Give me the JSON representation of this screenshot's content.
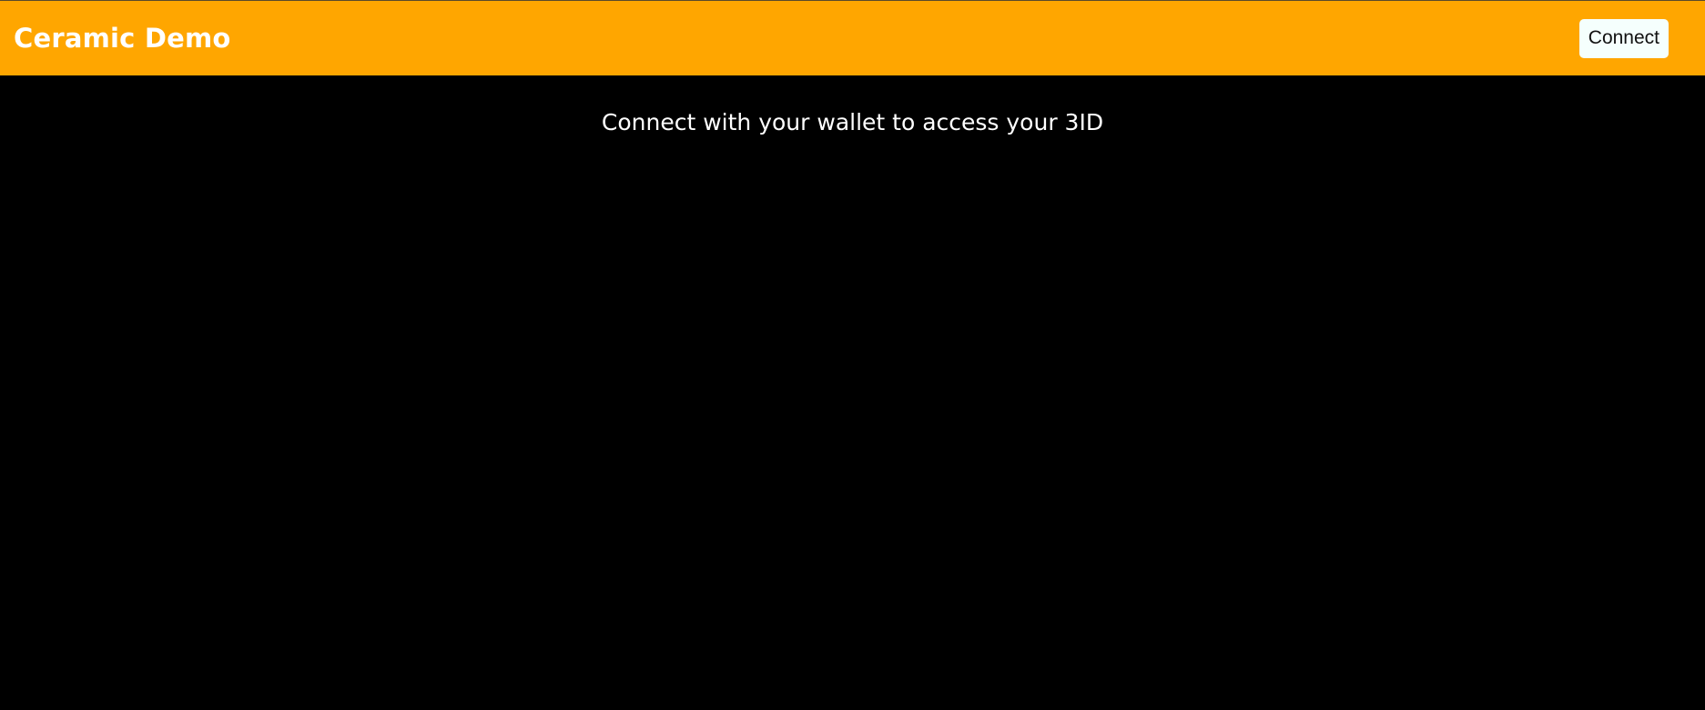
{
  "header": {
    "title": "Ceramic Demo",
    "connect_label": "Connect",
    "background_color": "#ffa600"
  },
  "main": {
    "prompt": "Connect with your wallet to access your 3ID",
    "background_color": "#000000"
  }
}
